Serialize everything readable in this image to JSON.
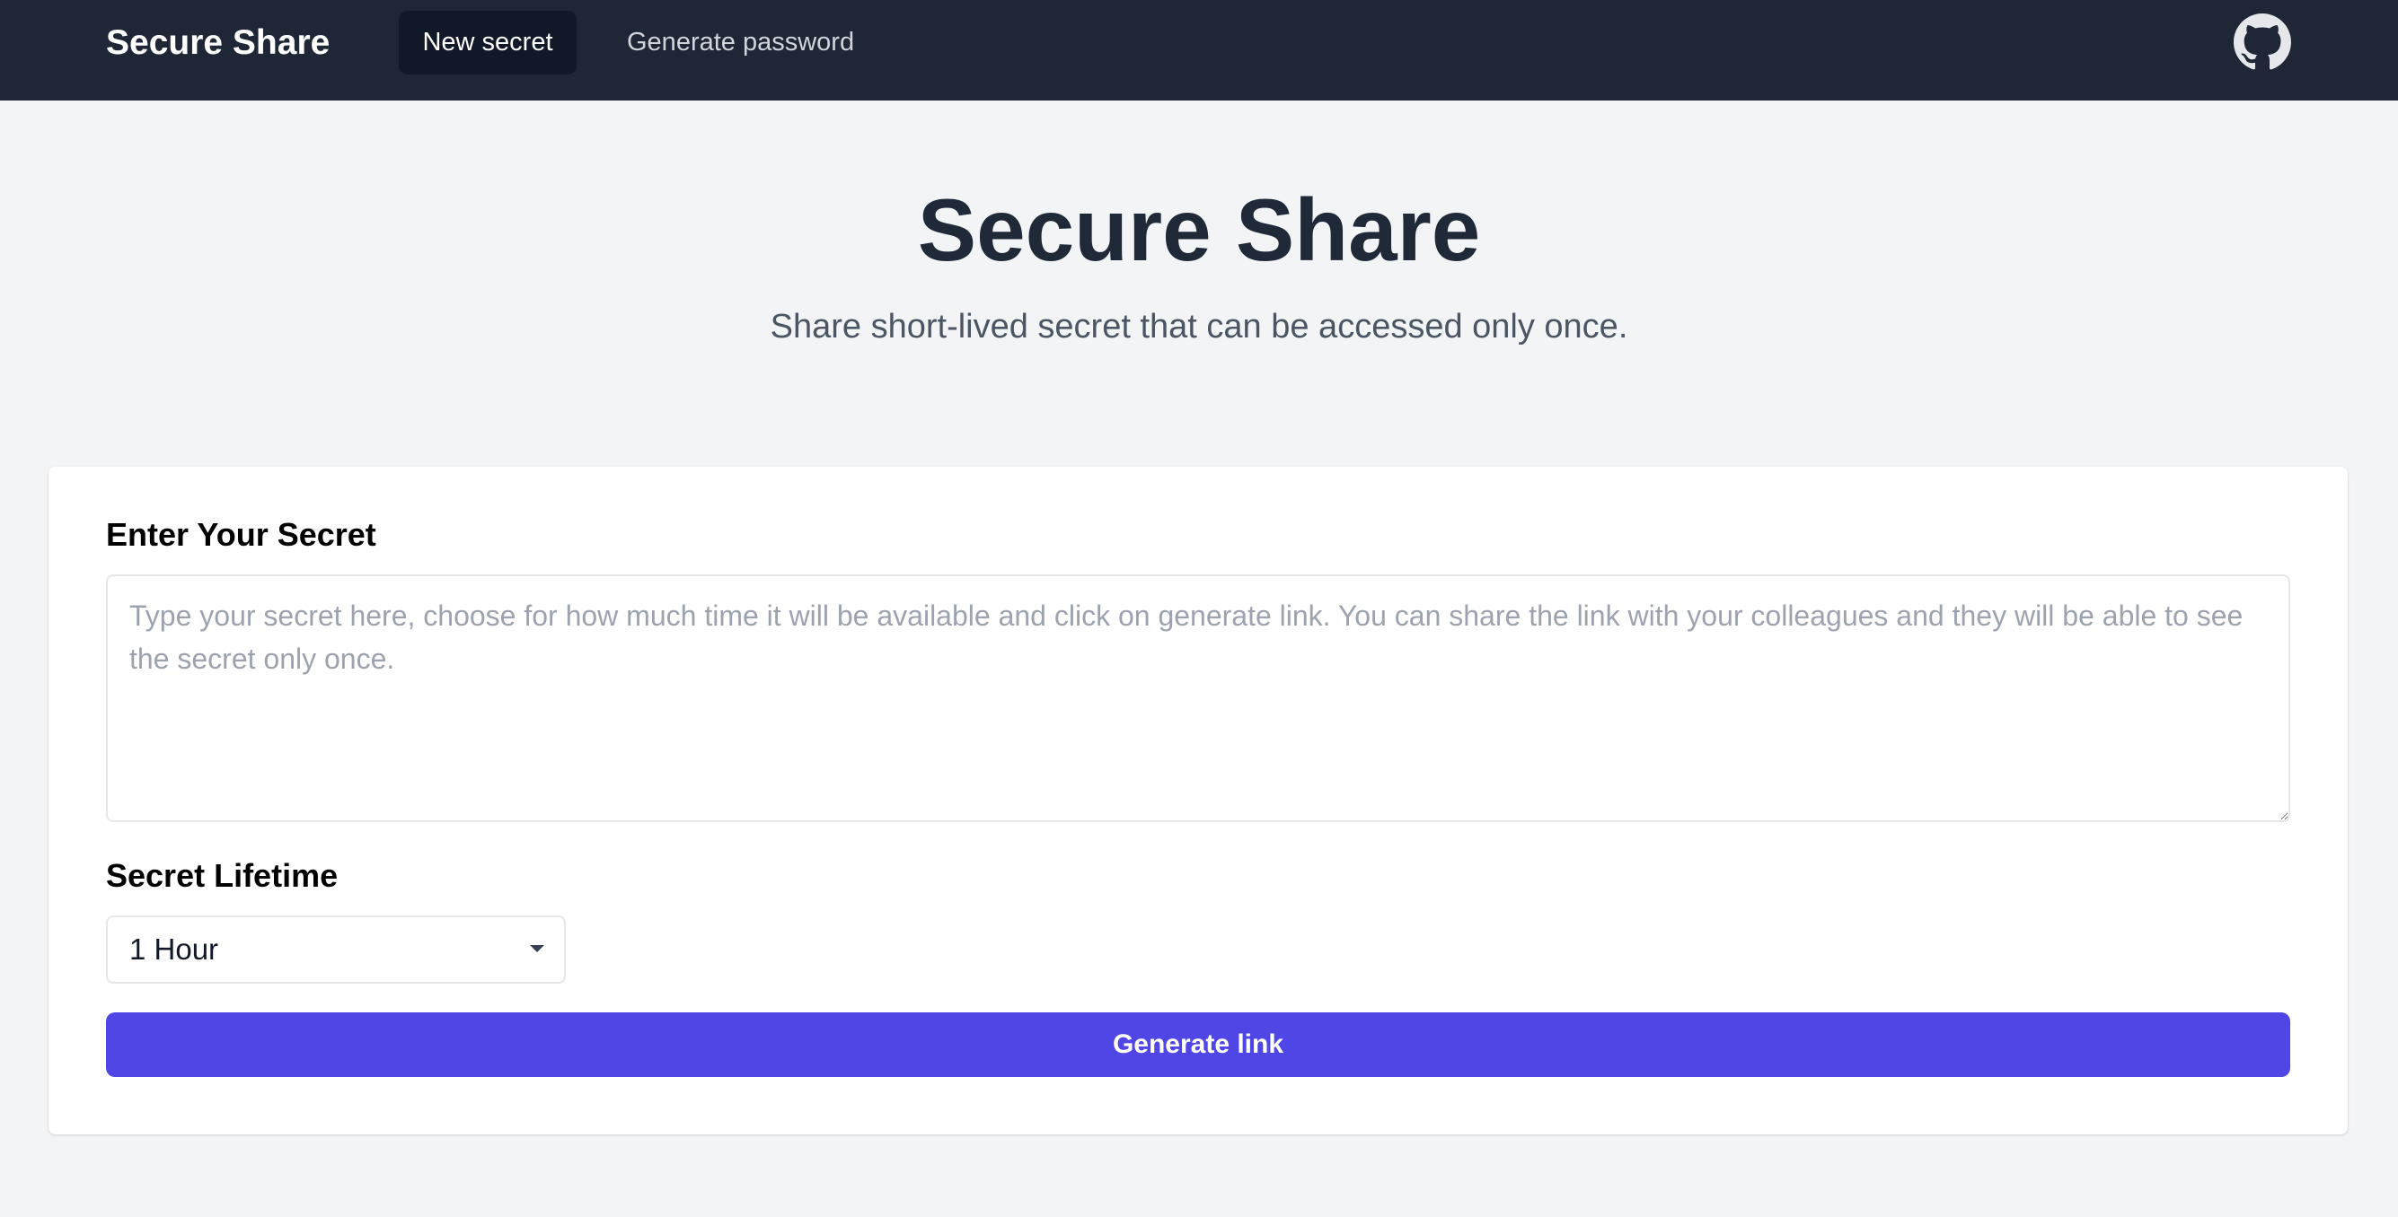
{
  "navbar": {
    "brand": "Secure Share",
    "items": [
      {
        "label": "New secret",
        "active": true
      },
      {
        "label": "Generate password",
        "active": false
      }
    ],
    "github_icon": "github-icon"
  },
  "hero": {
    "title": "Secure Share",
    "subtitle": "Share short-lived secret that can be accessed only once."
  },
  "form": {
    "secret_label": "Enter Your Secret",
    "secret_value": "",
    "secret_placeholder": "Type your secret here, choose for how much time it will be available and click on generate link. You can share the link with your colleagues and they will be able to see the secret only once.",
    "lifetime_label": "Secret Lifetime",
    "lifetime_selected": "1 Hour",
    "submit_label": "Generate link"
  },
  "colors": {
    "navbar_bg": "#1f2736",
    "active_nav_bg": "#111827",
    "page_bg": "#f3f4f6",
    "accent": "#4f46e5",
    "title_text": "#1f2937",
    "subtitle_text": "#4b5563"
  }
}
